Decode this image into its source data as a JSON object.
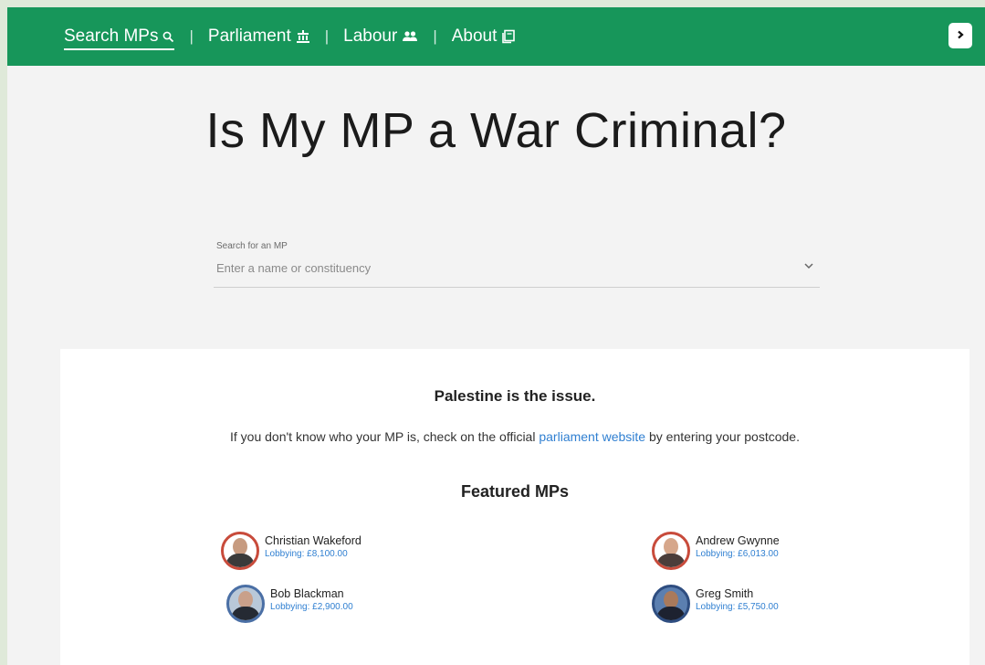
{
  "nav": {
    "items": [
      {
        "label": "Search MPs",
        "icon": "search-icon"
      },
      {
        "label": "Parliament",
        "icon": "parliament-icon"
      },
      {
        "label": "Labour",
        "icon": "people-icon"
      },
      {
        "label": "About",
        "icon": "book-icon"
      }
    ],
    "separator": "|",
    "toggle_icon": "chevron-right-icon"
  },
  "colors": {
    "brand_green": "#17965a",
    "link_blue": "#2f7fd1",
    "avatar_ring_red": "#c84b3b",
    "avatar_ring_blue": "#4a6fa5"
  },
  "title": "Is My MP a War Criminal?",
  "search": {
    "label": "Search for an MP",
    "placeholder": "Enter a name or constituency",
    "value": ""
  },
  "card": {
    "issue": "Palestine is the issue.",
    "info_before": "If you don't know who your MP is, check on the official ",
    "info_link": "parliament website",
    "info_after": " by entering your postcode.",
    "featured_title": "Featured MPs",
    "mps": [
      {
        "name": "Christian Wakeford",
        "lobbying": "Lobbying: £8,100.00"
      },
      {
        "name": "Andrew Gwynne",
        "lobbying": "Lobbying: £6,013.00"
      },
      {
        "name": "Bob Blackman",
        "lobbying": "Lobbying: £2,900.00"
      },
      {
        "name": "Greg Smith",
        "lobbying": "Lobbying: £5,750.00"
      }
    ]
  }
}
